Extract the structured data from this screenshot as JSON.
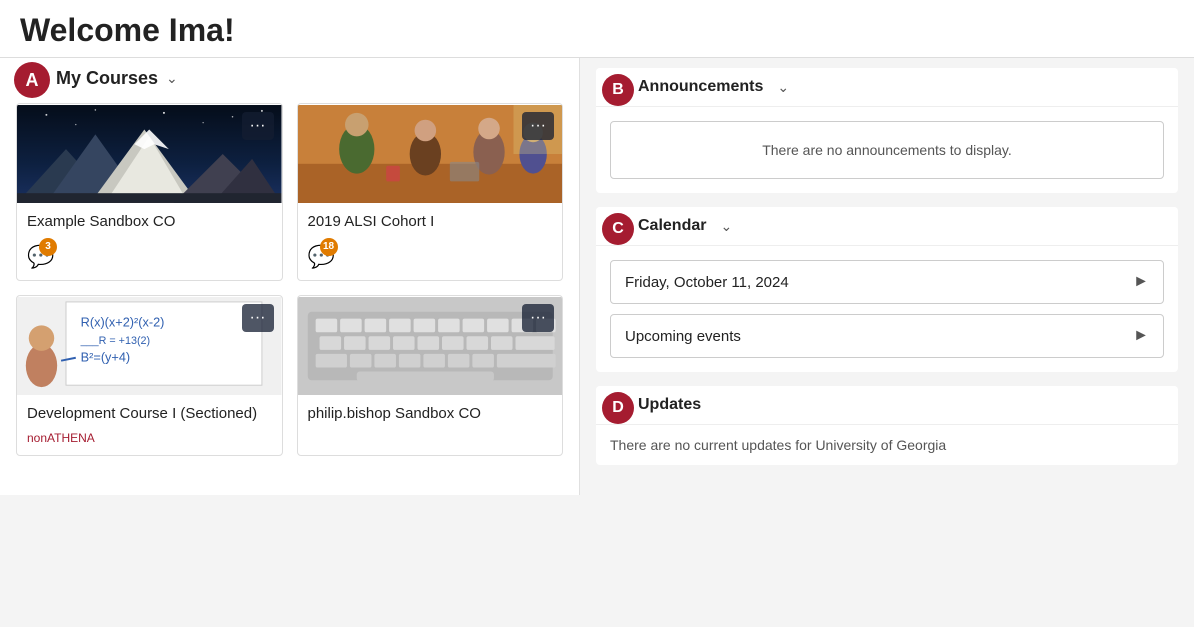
{
  "header": {
    "title": "Welcome Ima!"
  },
  "left": {
    "badge": "A",
    "section_title": "My Courses",
    "courses": [
      {
        "id": "sandbox-co",
        "name": "Example Sandbox CO",
        "subtitle": "",
        "image_type": "mountain",
        "notifications": 3
      },
      {
        "id": "alsi-cohort",
        "name": "2019 ALSI Cohort I",
        "subtitle": "",
        "image_type": "people",
        "notifications": 18
      },
      {
        "id": "dev-course",
        "name": "Development Course I (Sectioned)",
        "subtitle": "nonATHENA",
        "image_type": "whiteboard",
        "notifications": null
      },
      {
        "id": "bishop-sandbox",
        "name": "philip.bishop Sandbox CO",
        "subtitle": "",
        "image_type": "keyboard",
        "notifications": null
      }
    ]
  },
  "right": {
    "announcements": {
      "badge": "B",
      "title": "Announcements",
      "empty_message": "There are no announcements to display."
    },
    "calendar": {
      "badge": "C",
      "title": "Calendar",
      "date_row": "Friday, October 11, 2024",
      "events_row": "Upcoming events"
    },
    "updates": {
      "badge": "D",
      "title": "Updates",
      "message": "There are no current updates for University of Georgia"
    }
  },
  "icons": {
    "chevron_down": "⌄",
    "chevron_right": "▶",
    "ellipsis": "···",
    "chat": "💬"
  }
}
